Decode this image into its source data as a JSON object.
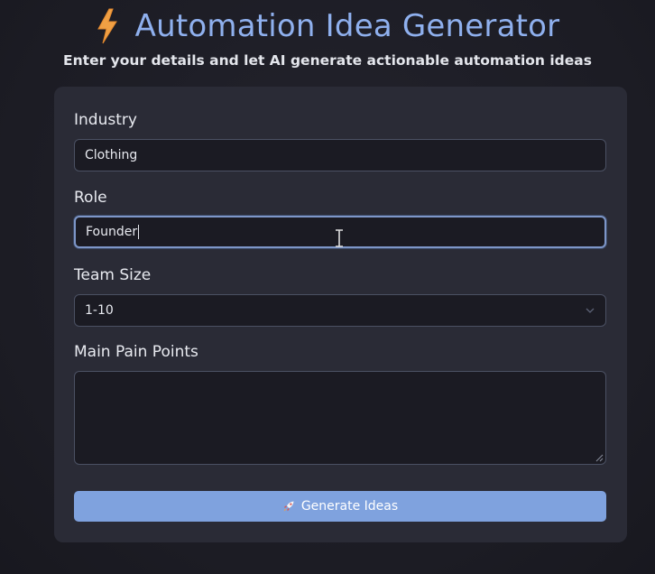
{
  "header": {
    "title": "Automation Idea Generator",
    "subtitle": "Enter your details and let AI generate actionable automation ideas",
    "icon": "lightning-bolt-icon"
  },
  "form": {
    "industry": {
      "label": "Industry",
      "value": "Clothing"
    },
    "role": {
      "label": "Role",
      "value": "Founder"
    },
    "team_size": {
      "label": "Team Size",
      "value": "1-10"
    },
    "pain_points": {
      "label": "Main Pain Points",
      "value": ""
    },
    "submit": {
      "label": "Generate Ideas",
      "icon": "rocket-icon"
    }
  },
  "colors": {
    "accent": "#7fa2de",
    "title": "#8fb0ee",
    "card": "#2a2b36",
    "background": "#1e1e26"
  }
}
